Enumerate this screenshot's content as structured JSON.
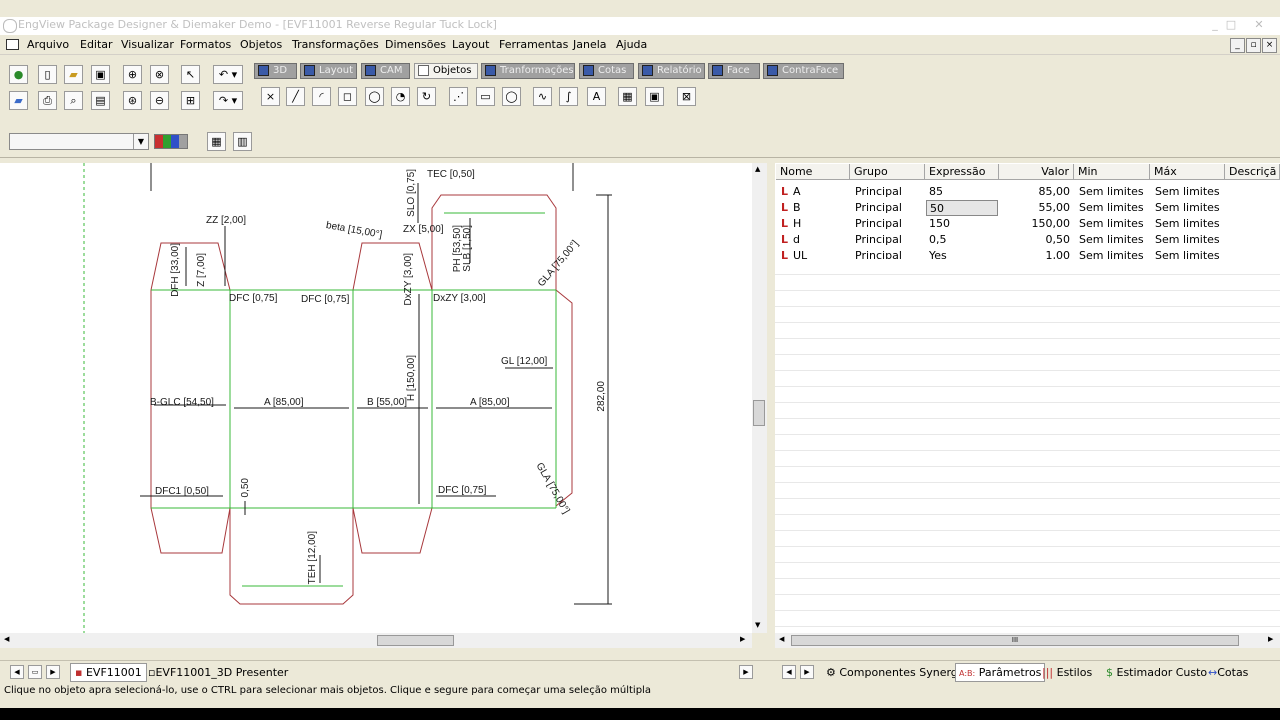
{
  "window": {
    "title": "EngView Package Designer & Diemaker Demo - [EVF11001 Reverse Regular Tuck Lock]",
    "minimize": "_",
    "maximize": "□",
    "close": "✕"
  },
  "menu": [
    "Arquivo",
    "Editar",
    "Visualizar",
    "Formatos",
    "Objetos",
    "Transformações",
    "Dimensões",
    "Layout",
    "Ferramentas",
    "Janela",
    "Ajuda"
  ],
  "view_tabs": [
    {
      "label": "3D",
      "icon": "cube-icon"
    },
    {
      "label": "Layout",
      "icon": "layout-icon"
    },
    {
      "label": "CAM",
      "icon": "cam-icon"
    },
    {
      "label": "Objetos",
      "icon": "objects-icon",
      "active": true
    },
    {
      "label": "Tranformações",
      "icon": "transform-icon"
    },
    {
      "label": "Cotas",
      "icon": "dimension-icon"
    },
    {
      "label": "Relatório",
      "icon": "report-icon"
    },
    {
      "label": "Face",
      "icon": "face-icon"
    },
    {
      "label": "ContraFace",
      "icon": "counterface-icon"
    }
  ],
  "drawing": {
    "labels": {
      "tec": "TEC [0,50]",
      "slo": "SLO [0,75]",
      "zz": "ZZ [2,00]",
      "beta": "beta [15,00°]",
      "zx": "ZX [5,00]",
      "ph": "PH [53,50]",
      "slb": "SLB [1,50]",
      "dfh": "DFH [33,00]",
      "z": "Z [7,00]",
      "dfc1": "DFC [0,75]",
      "dfc2": "DFC [0,75]",
      "dxzy1": "DxZY [3,00]",
      "dxzy2": "DxZY [3,00]",
      "gla1": "GLA [75,00°]",
      "gl": "GL [12,00]",
      "h150": "H [150,00]",
      "dim282": "282,00",
      "bglc": "B-GLC [54,50]",
      "a1": "A [85,00]",
      "b1": "B [55,00]",
      "a2": "A [85,00]",
      "gla2": "GLA [75,00°]",
      "dfc3": "DFC1 [0,50]",
      "d050": "0,50",
      "dfc4": "DFC [0,75]",
      "teh": "TEH [12,00]"
    }
  },
  "params": {
    "headers": [
      "Nome",
      "Grupo",
      "Expressão",
      "Valor",
      "Min",
      "Máx",
      "Descriçã"
    ],
    "rows": [
      {
        "name": "A",
        "group": "Principal",
        "expr": "85",
        "value": "85,00",
        "min": "Sem limites",
        "max": "Sem limites"
      },
      {
        "name": "B",
        "group": "Principal",
        "expr": "50",
        "value": "55,00",
        "min": "Sem limites",
        "max": "Sem limites"
      },
      {
        "name": "H",
        "group": "Principal",
        "expr": "150",
        "value": "150,00",
        "min": "Sem limites",
        "max": "Sem limites"
      },
      {
        "name": "d",
        "group": "Principal",
        "expr": "0,5",
        "value": "0,50",
        "min": "Sem limites",
        "max": "Sem limites"
      },
      {
        "name": "UL",
        "group": "Principal",
        "expr": "Yes",
        "value": "1,00",
        "min": "Sem limites",
        "max": "Sem limites"
      }
    ],
    "param_icon": "L",
    "scroll_grip": "III"
  },
  "sheet_tabs": [
    "EVF11001",
    "EVF11001_3D Presenter"
  ],
  "panel_tabs": [
    "Componentes Synergy",
    "Parâmetros",
    "Estilos",
    "Estimador Custo",
    "Cotas"
  ],
  "panel_tab_glyphs": [
    "⚙",
    "A:B:",
    "|||",
    "$",
    "↔"
  ],
  "status": "Clique no objeto apra selecioná-lo, use o CTRL para selecionar mais objetos. Clique e segure para começar uma seleção múltipla",
  "colors": {
    "cut": "#a8383c",
    "crease": "#38b838",
    "dim": "#1a1a1a"
  }
}
